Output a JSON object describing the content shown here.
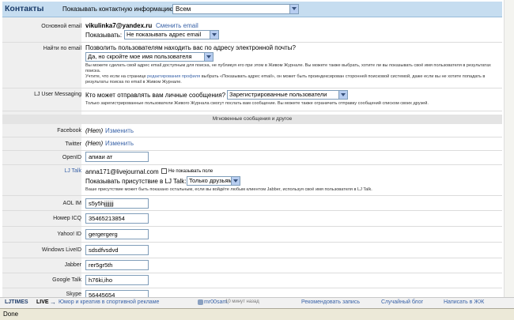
{
  "header": {
    "title": "Контакты",
    "show_label": "Показывать контактную информацию",
    "show_value": "Всем"
  },
  "main_email": {
    "label": "Основной email",
    "value": "vikulinka7@yandex.ru",
    "change_link": "Сменить email",
    "show_label": "Показывать:",
    "show_value": "Не показывать адрес email"
  },
  "find_email": {
    "label": "Найти по email",
    "question": "Позволить пользователям находить вас по адресу электронной почты?",
    "select_value": "Да, но скройте мое имя пользователя",
    "help1": "Вы можете сделать свой адрес email доступным для поиска, не публикуя его при этом в Живом Журнале. Вы можете также выбрать, хотите ли вы показывать своё имя пользователя в результатах поиска.",
    "help2_pre": "Учтите, что если на странице ",
    "help2_link": "редактирования профиля",
    "help2_post": " выбрать «Показывать адрес email», он может быть проиндексирован сторонней поисковой системой, даже если вы не хотите попадать в результаты поиска по email в Живом Журнале."
  },
  "messaging": {
    "label": "LJ User Messaging",
    "question": "Кто может отправлять вам личные сообщения?",
    "select_value": "Зарегистрированные пользователи",
    "help": "Только зарегистрированные пользователи Живого Журнала смогут послать вам сообщение. Вы можете также ограничить отправку сообщений списком своих друзей."
  },
  "section_title": "Мгновенные сообщения и другое",
  "facebook": {
    "label": "Facebook",
    "status": "(Нет)",
    "link": "Изменить"
  },
  "twitter": {
    "label": "Twitter",
    "status": "(Нет)",
    "link": "Изменить"
  },
  "openid": {
    "label": "OpenID",
    "value": "апиаи ат"
  },
  "ljtalk": {
    "label": "LJ Talk",
    "address": "anna171@livejournal.com",
    "hide_label": "Не показывать поле",
    "presence_label": "Показывать присутствие в LJ Talk:",
    "presence_value": "Только друзьям",
    "help": "Ваше присутствие может быть показано остальным, если вы войдёте любым клиентом Jabber, используя своё имя пользователя в LJ Talk."
  },
  "aol": {
    "label": "AOL IM",
    "value": "s5y5hjjjjjjj"
  },
  "icq": {
    "label": "Номер ICQ",
    "value": "35465213854"
  },
  "yahoo": {
    "label": "Yahoo! ID",
    "value": "gergergerg"
  },
  "windows": {
    "label": "Windows LiveID",
    "value": "sdsdfvsdvd"
  },
  "jabber": {
    "label": "Jabber",
    "value": "rer5gr5th"
  },
  "gtalk": {
    "label": "Google Talk",
    "value": "h76ki,iho"
  },
  "skype": {
    "label": "Skype",
    "value": "56445654"
  },
  "bottombar": {
    "brand": "LJTIMES",
    "live": "LIVE",
    "arrow": "→",
    "headline": "Юмор и креатив в спортивной рекламе",
    "user": "mr00sam,",
    "time": "10 минут назад",
    "link1": "Рекомендовать запись",
    "link2": "Случайный блог",
    "link3": "Написать в ЖЖ"
  },
  "statusbar": {
    "text": "Done"
  }
}
